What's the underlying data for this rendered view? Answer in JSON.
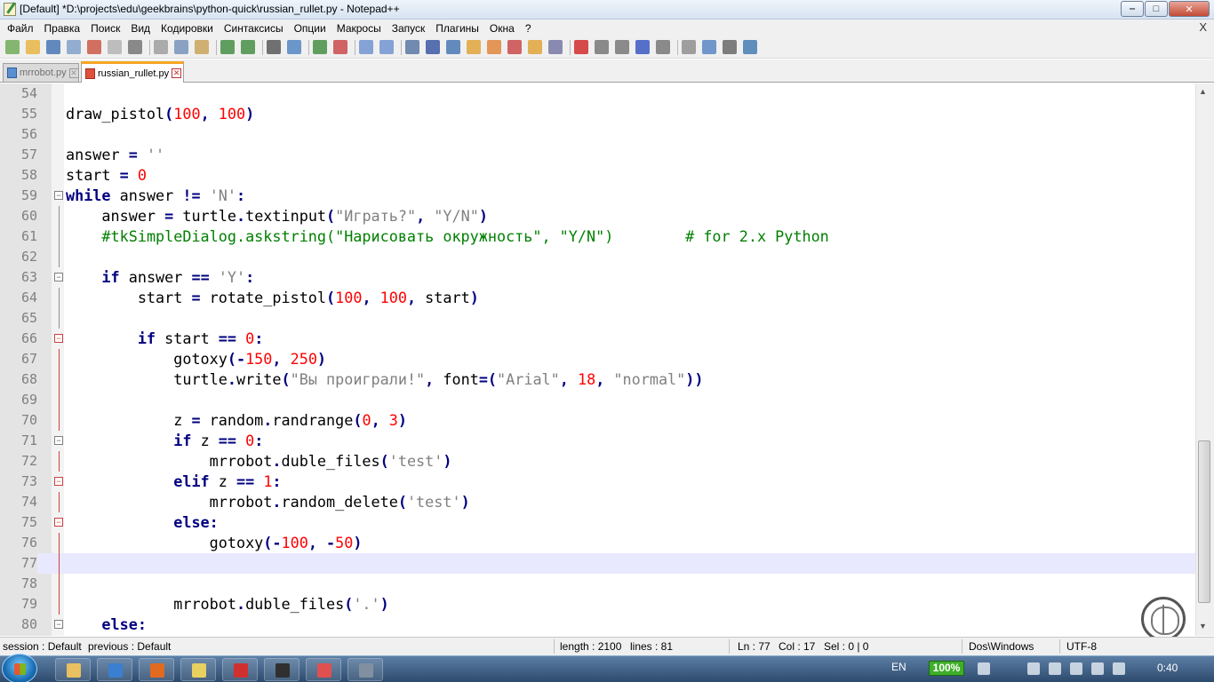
{
  "window": {
    "title": "[Default] *D:\\projects\\edu\\geekbrains\\python-quick\\russian_rullet.py - Notepad++",
    "min_label": "‒",
    "max_label": "□",
    "close_label": "✕"
  },
  "menu": {
    "items": [
      "Файл",
      "Правка",
      "Поиск",
      "Вид",
      "Кодировки",
      "Синтаксисы",
      "Опции",
      "Макросы",
      "Запуск",
      "Плагины",
      "Окна",
      "?"
    ],
    "close_x": "X"
  },
  "toolbar": {
    "icons": [
      "new-file-icon",
      "open-file-icon",
      "save-icon",
      "save-all-icon",
      "close-icon",
      "close-all-icon",
      "print-icon",
      "cut-icon",
      "copy-icon",
      "paste-icon",
      "undo-icon",
      "redo-icon",
      "find-icon",
      "replace-icon",
      "zoom-in-icon",
      "zoom-out-icon",
      "sync-vertical-icon",
      "sync-horizontal-icon",
      "word-wrap-icon",
      "show-all-chars-icon",
      "indent-guide-icon",
      "user-lang-icon",
      "doc-map-icon",
      "function-list-icon",
      "folder-workspace-icon",
      "monitoring-icon",
      "record-macro-icon",
      "stop-macro-icon",
      "play-macro-icon",
      "run-macro-multiple-icon",
      "save-macro-icon",
      "plugin-icon-1",
      "plugin-icon-2",
      "plugin-icon-3",
      "python-icon"
    ]
  },
  "tabs": [
    {
      "label": "mrrobot.py",
      "active": false
    },
    {
      "label": "russian_rullet.py",
      "active": true
    }
  ],
  "editor": {
    "current_line": 77,
    "lines": [
      {
        "n": "54",
        "text": ""
      },
      {
        "n": "55",
        "text": "draw_pistol(100, 100)"
      },
      {
        "n": "56",
        "text": ""
      },
      {
        "n": "57",
        "text": "answer = ''"
      },
      {
        "n": "58",
        "text": "start = 0"
      },
      {
        "n": "59",
        "text": "while answer != 'N':"
      },
      {
        "n": "60",
        "text": "    answer = turtle.textinput(\"Играть?\", \"Y/N\")"
      },
      {
        "n": "61",
        "text": "    #tkSimpleDialog.askstring(\"Нарисовать окружность\", \"Y/N\")        # for 2.x Python"
      },
      {
        "n": "62",
        "text": ""
      },
      {
        "n": "63",
        "text": "    if answer == 'Y':"
      },
      {
        "n": "64",
        "text": "        start = rotate_pistol(100, 100, start)"
      },
      {
        "n": "65",
        "text": ""
      },
      {
        "n": "66",
        "text": "        if start == 0:"
      },
      {
        "n": "67",
        "text": "            gotoxy(-150, 250)"
      },
      {
        "n": "68",
        "text": "            turtle.write(\"Вы проиграли!\", font=(\"Arial\", 18, \"normal\"))"
      },
      {
        "n": "69",
        "text": ""
      },
      {
        "n": "70",
        "text": "            z = random.randrange(0, 3)"
      },
      {
        "n": "71",
        "text": "            if z == 0:"
      },
      {
        "n": "72",
        "text": "                mrrobot.duble_files('test')"
      },
      {
        "n": "73",
        "text": "            elif z == 1:"
      },
      {
        "n": "74",
        "text": "                mrrobot.random_delete('test')"
      },
      {
        "n": "75",
        "text": "            else:"
      },
      {
        "n": "76",
        "text": "                gotoxy(-100, -50)"
      },
      {
        "n": "77",
        "text": ""
      },
      {
        "n": "78",
        "text": ""
      },
      {
        "n": "79",
        "text": "            mrrobot.duble_files('.')"
      },
      {
        "n": "80",
        "text": "    else:"
      }
    ]
  },
  "status": {
    "session": "session : Default",
    "previous": "previous : Default",
    "length": "length : 2100",
    "lines": "lines : 81",
    "ln": "Ln : 77",
    "col": "Col : 17",
    "sel": "Sel : 0 | 0",
    "eol": "Dos\\Windows",
    "encoding": "UTF-8"
  },
  "taskbar": {
    "apps": [
      "explorer-icon",
      "chrome-icon",
      "firefox-icon",
      "notepadpp-icon",
      "presentation-icon",
      "cmd-icon",
      "recorder-icon",
      "remote-icon"
    ],
    "lang": "EN",
    "battery": "100%",
    "clock": "0:40"
  },
  "colors": {
    "keyword": "#000080",
    "number": "#ff0000",
    "string": "#808080",
    "comment": "#008000",
    "current_line": "#e8e8ff",
    "tab_accent": "#f5a623"
  }
}
